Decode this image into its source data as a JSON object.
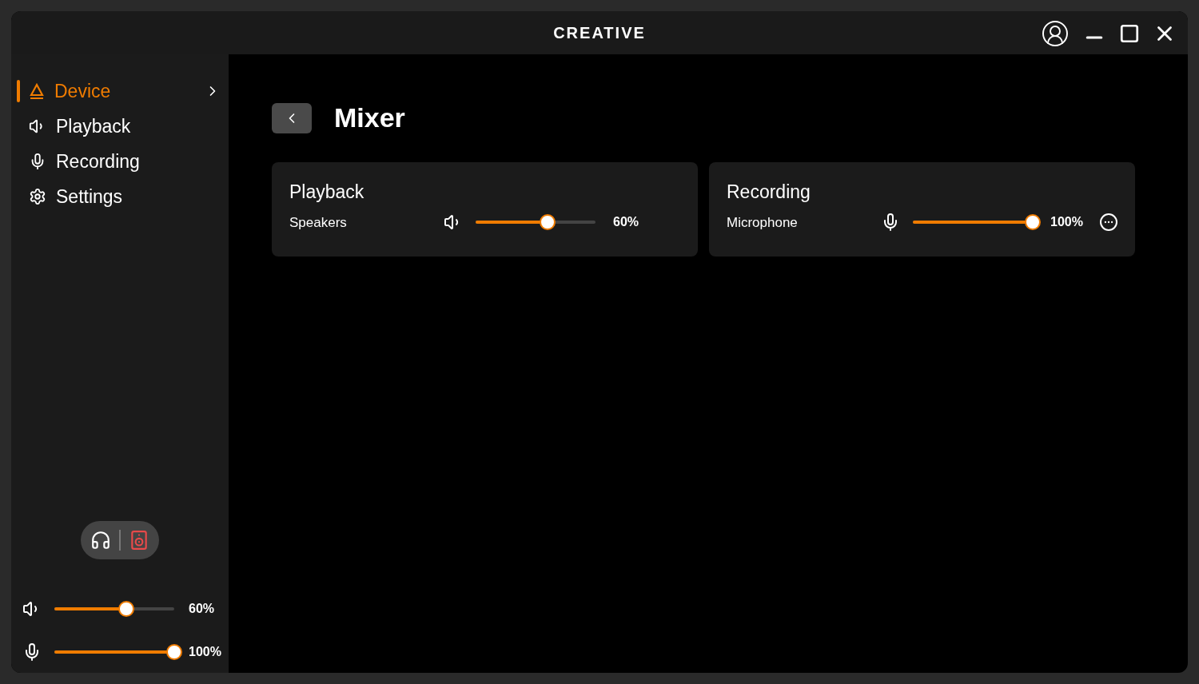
{
  "window": {
    "logo": "CREATIVE"
  },
  "sidebar": {
    "items": [
      {
        "label": "Device",
        "kind": "device",
        "selected": true
      },
      {
        "label": "Playback",
        "kind": "playback",
        "selected": false
      },
      {
        "label": "Recording",
        "kind": "recording",
        "selected": false
      },
      {
        "label": "Settings",
        "kind": "settings",
        "selected": false
      }
    ],
    "outputs": [
      {
        "kind": "headphones",
        "selected": false
      },
      {
        "kind": "speaker",
        "selected": true
      }
    ],
    "sliders": [
      {
        "kind": "playback",
        "level": 0.6,
        "reading": "60%"
      },
      {
        "kind": "recording",
        "level": 1.0,
        "reading": "100%"
      }
    ]
  },
  "page": {
    "title": "Mixer",
    "cards": [
      {
        "title": "Playback",
        "device": "Speakers",
        "kind": "playback",
        "level": 0.6,
        "reading": "60%",
        "more": false
      },
      {
        "title": "Recording",
        "device": "Microphone",
        "kind": "recording",
        "level": 1.0,
        "reading": "100%",
        "more": true
      }
    ]
  }
}
